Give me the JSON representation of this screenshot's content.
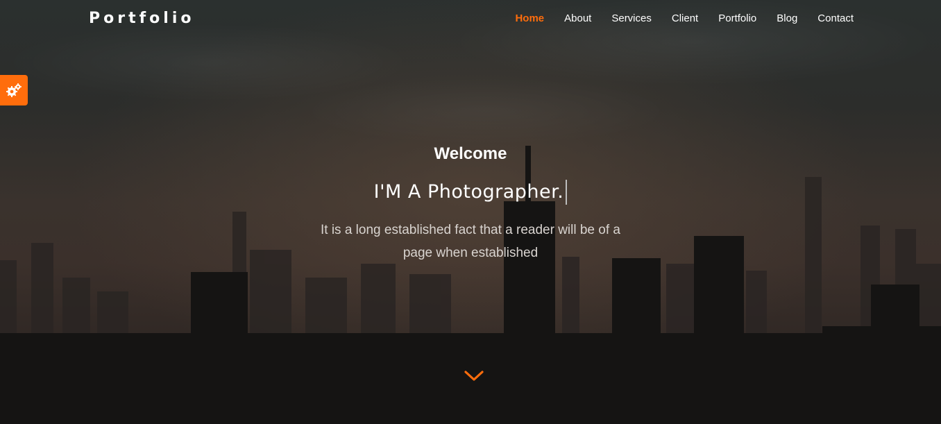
{
  "brand": {
    "name": "Portfolio"
  },
  "nav": {
    "items": [
      {
        "label": "Home",
        "active": true
      },
      {
        "label": "About",
        "active": false
      },
      {
        "label": "Services",
        "active": false
      },
      {
        "label": "Client",
        "active": false
      },
      {
        "label": "Portfolio",
        "active": false
      },
      {
        "label": "Blog",
        "active": false
      },
      {
        "label": "Contact",
        "active": false
      }
    ]
  },
  "settings": {
    "icon": "gears-icon"
  },
  "hero": {
    "welcome": "Welcome",
    "headline": "I'M A Photographer.",
    "description": "It is a long established fact that a reader will be of a page when established",
    "scroll_icon": "chevron-down-icon"
  },
  "colors": {
    "accent": "#ff6d0c",
    "text": "#ffffff",
    "muted": "#d9d4d0"
  }
}
